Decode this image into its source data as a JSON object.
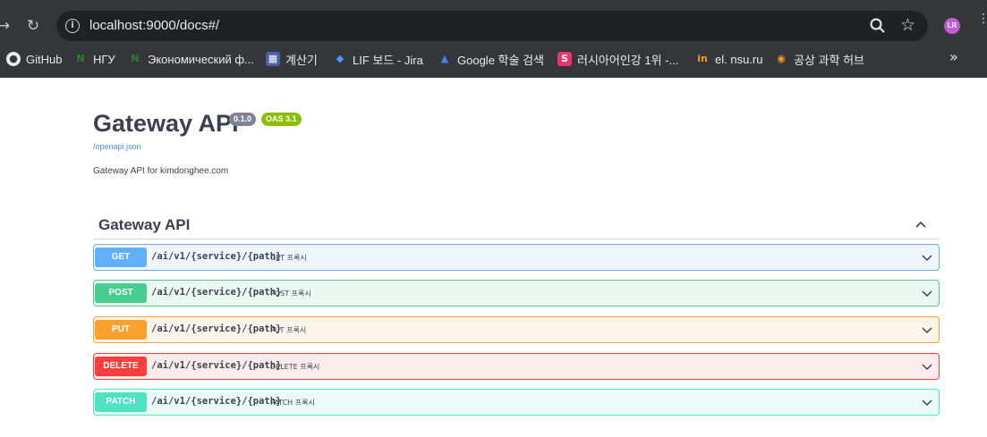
{
  "browser": {
    "url": "localhost:9000/docs#/",
    "profile_initials": "LR",
    "bookmarks": [
      {
        "label": "GitHub",
        "icon": "github-icon"
      },
      {
        "label": "НГУ",
        "icon": "ngu-icon"
      },
      {
        "label": "Экономический ф...",
        "icon": "econ-icon"
      },
      {
        "label": "계산기",
        "icon": "calculator-icon"
      },
      {
        "label": "LIF 보드 - Jira",
        "icon": "jira-icon"
      },
      {
        "label": "Google 학술 검색",
        "icon": "scholar-icon"
      },
      {
        "label": "러시아어인강 1위 -...",
        "icon": "s-icon"
      },
      {
        "label": "el. nsu.ru",
        "icon": "nsu-icon"
      },
      {
        "label": "공상 과학 허브",
        "icon": "eye-icon"
      }
    ],
    "more_label": "»"
  },
  "info": {
    "title": "Gateway API",
    "version": "0.1.0",
    "oas": "OAS 3.1",
    "spec_link": "/openapi.json",
    "description": "Gateway API for kimdonghee.com"
  },
  "tag": {
    "name": "Gateway API"
  },
  "operations": [
    {
      "method": "GET",
      "path": "/ai/v1/{service}/{path}",
      "summary": "GET 프록시",
      "color": "#61affe"
    },
    {
      "method": "POST",
      "path": "/ai/v1/{service}/{path}",
      "summary": "POST 프록시",
      "color": "#49cc90"
    },
    {
      "method": "PUT",
      "path": "/ai/v1/{service}/{path}",
      "summary": "PUT 프록시",
      "color": "#fca130"
    },
    {
      "method": "DELETE",
      "path": "/ai/v1/{service}/{path}",
      "summary": "DELETE 프록시",
      "color": "#f93e3e"
    },
    {
      "method": "PATCH",
      "path": "/ai/v1/{service}/{path}",
      "summary": "PATCH 프록시",
      "color": "#50e3c2"
    }
  ]
}
